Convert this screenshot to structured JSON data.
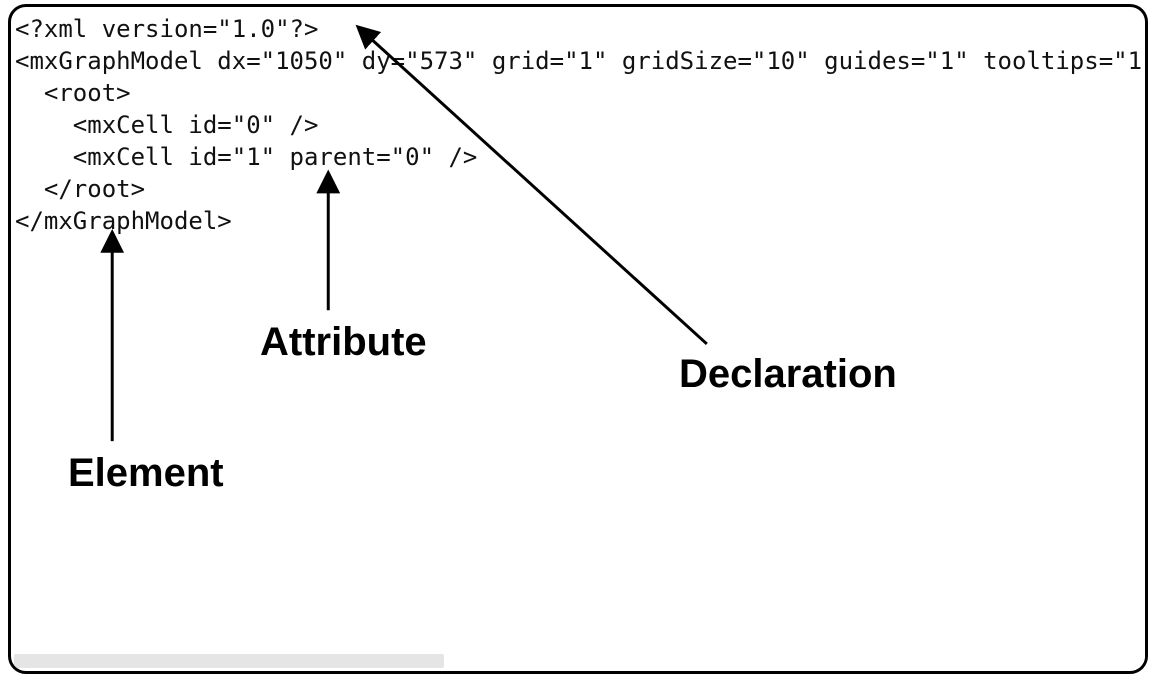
{
  "code": {
    "line1": "<?xml version=\"1.0\"?>",
    "line2": "<mxGraphModel dx=\"1050\" dy=\"573\" grid=\"1\" gridSize=\"10\" guides=\"1\" tooltips=\"1",
    "line3": "  <root>",
    "line4": "    <mxCell id=\"0\" />",
    "line5": "    <mxCell id=\"1\" parent=\"0\" />",
    "line6": "  </root>",
    "line7": "</mxGraphModel>"
  },
  "labels": {
    "attribute": "Attribute",
    "declaration": "Declaration",
    "element": "Element"
  }
}
